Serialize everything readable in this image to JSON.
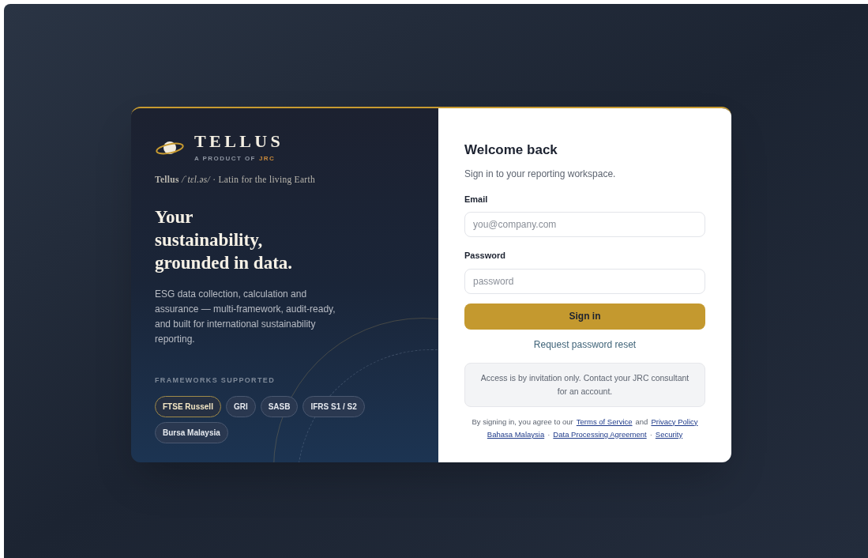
{
  "brand": {
    "name": "TELLUS",
    "tagline": "A PRODUCT OF",
    "org": "JRC",
    "etymology": "**Tellus** */ˈtɛl.əs/* · Latin for the living Earth"
  },
  "hero": {
    "headline": [
      "Your",
      "sustainability,",
      "grounded in data."
    ],
    "description": "ESG data collection, calculation and assurance — multi-framework, audit-ready, and built for international sustainability reporting."
  },
  "frameworks": {
    "heading": "FRAMEWORKS SUPPORTED",
    "items": [
      {
        "label": "FTSE Russell",
        "highlighted": true
      },
      {
        "label": "GRI",
        "highlighted": false
      },
      {
        "label": "SASB",
        "highlighted": false
      },
      {
        "label": "IFRS S1 / S2",
        "highlighted": false
      },
      {
        "label": "Bursa Malaysia",
        "highlighted": false
      }
    ]
  },
  "form": {
    "title": "Welcome back",
    "subtitle": "Sign in to your reporting workspace.",
    "fields": [
      {
        "label": "Email",
        "placeholder": "you@company.com"
      },
      {
        "label": "Password",
        "placeholder": "password"
      }
    ],
    "submit": "Sign in",
    "reset_link": "Request password reset",
    "notice": "Access is by invitation only. Contact your JRC consultant for an account.",
    "legal": [
      [
        {
          "kind": "text",
          "text": "By signing in, you agree to our"
        },
        {
          "kind": "link",
          "text": "Terms of Service"
        },
        {
          "kind": "text",
          "text": "and"
        },
        {
          "kind": "link",
          "text": "Privacy Policy"
        }
      ],
      [
        {
          "kind": "link",
          "text": "Bahasa Malaysia"
        },
        {
          "kind": "sep",
          "text": "·"
        },
        {
          "kind": "link",
          "text": "Data Processing Agreement"
        },
        {
          "kind": "sep",
          "text": "·"
        },
        {
          "kind": "link",
          "text": "Security"
        }
      ]
    ]
  }
}
